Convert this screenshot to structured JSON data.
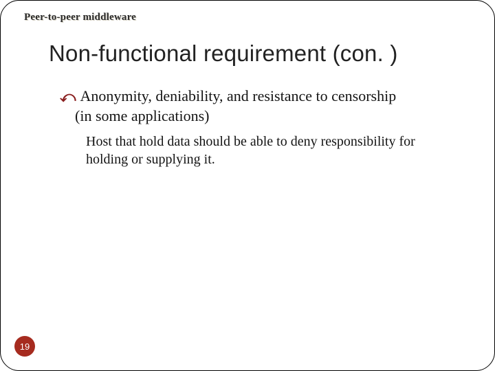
{
  "header": "Peer-to-peer middleware",
  "title": "Non-functional requirement (con. )",
  "bullet": {
    "line1": "Anonymity, deniability, and resistance to censorship",
    "line2": "(in some applications)"
  },
  "sub": "Host that hold data should be able to deny responsibility for holding or supplying it.",
  "page_number": "19"
}
